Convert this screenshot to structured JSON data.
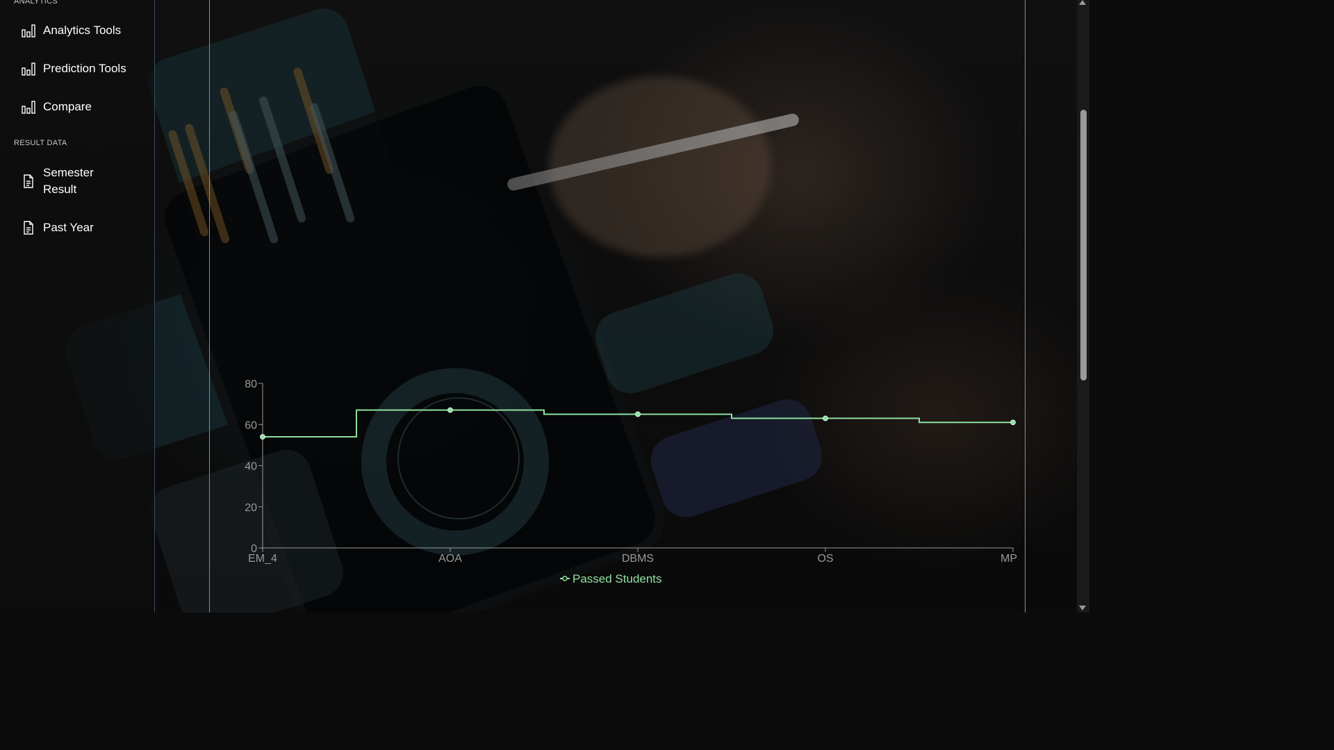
{
  "sidebar": {
    "sections": [
      {
        "title": "ANALYTICS",
        "items": [
          {
            "label": "Analytics Tools",
            "icon": "bar-chart-icon"
          },
          {
            "label": "Prediction Tools",
            "icon": "bar-chart-icon"
          },
          {
            "label": "Compare",
            "icon": "bar-chart-icon"
          }
        ]
      },
      {
        "title": "RESULT DATA",
        "items": [
          {
            "label": "Semester Result",
            "icon": "document-icon"
          },
          {
            "label": "Past Year",
            "icon": "document-icon"
          }
        ]
      }
    ]
  },
  "colors": {
    "series": "#8fe0a0",
    "axis": "#9a9a9a",
    "sidebar_border": "#3b4a66",
    "panel_border": "#8a8f99"
  },
  "chart_data": {
    "type": "line",
    "interpolation": "step",
    "categories": [
      "EM_4",
      "AOA",
      "DBMS",
      "OS",
      "MP"
    ],
    "series": [
      {
        "name": "Passed Students",
        "values": [
          54,
          67,
          65,
          63,
          61
        ]
      }
    ],
    "ylim": [
      0,
      80
    ],
    "yticks": [
      0,
      20,
      40,
      60,
      80
    ],
    "legend": "bottom-center",
    "grid": false
  }
}
